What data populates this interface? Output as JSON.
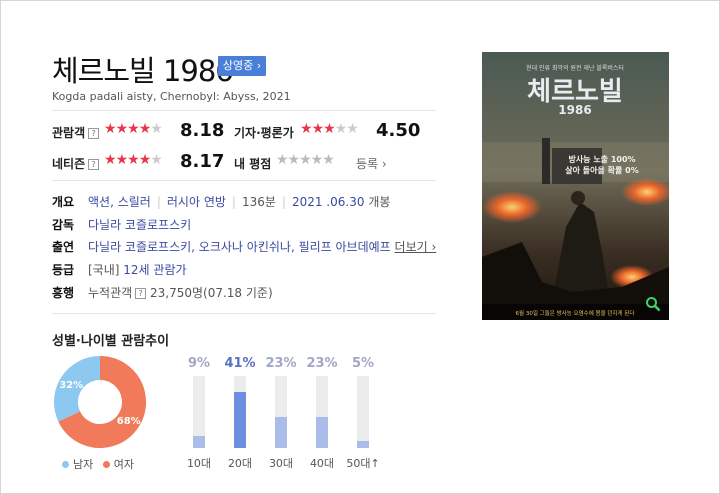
{
  "movie": {
    "title": "체르노빌 1986",
    "status_badge": "상영중 ›",
    "original_title": "Kogda padali aisty, Chernobyl: Abyss, 2021"
  },
  "ratings": {
    "audience": {
      "label": "관람객",
      "help": "?",
      "stars": "★★★★★",
      "value": "8.18",
      "fill": 0.818
    },
    "critic": {
      "label": "기자·평론가",
      "stars": "★★★★★",
      "value": "4.50",
      "fill": 0.45
    },
    "netizen": {
      "label": "네티즌",
      "help": "?",
      "stars": "★★★★★",
      "value": "8.17",
      "fill": 0.817
    },
    "mine": {
      "label": "내 평점",
      "stars": "★★★★★",
      "register": "등록 ›"
    }
  },
  "info": {
    "overview": {
      "label": "개요",
      "genres": "액션, 스릴러",
      "country": "러시아 연방",
      "runtime": "136분",
      "release": "2021 .06.30",
      "release_suffix": "개봉"
    },
    "director": {
      "label": "감독",
      "value": "다닐라 코즐로프스키"
    },
    "cast": {
      "label": "출연",
      "value": "다닐라 코즐로프스키, 오크사나 아킨쉬나, 필리프 아브데예프",
      "more": "더보기 ›"
    },
    "grade": {
      "label": "등급",
      "prefix": "[국내]",
      "value": "12세 관람가"
    },
    "boxoffice": {
      "label": "흥행",
      "prefix": "누적관객",
      "help": "?",
      "value": "23,750명",
      "date": "(07.18 기준)"
    }
  },
  "audience_trend": {
    "title": "성별·나이별 관람추이",
    "gender": [
      {
        "name": "남자",
        "label": "32%",
        "value": 32,
        "color": "#8cc8f0"
      },
      {
        "name": "여자",
        "label": "68%",
        "value": 68,
        "color": "#f07a5a"
      }
    ],
    "ages": [
      {
        "age": "10대",
        "label": "9%",
        "value": 9
      },
      {
        "age": "20대",
        "label": "41%",
        "value": 41,
        "highlight": true
      },
      {
        "age": "30대",
        "label": "23%",
        "value": 23
      },
      {
        "age": "40대",
        "label": "23%",
        "value": 23
      },
      {
        "age": "50대↑",
        "label": "5%",
        "value": 5
      }
    ],
    "colors": {
      "bar": "#a9bde8",
      "bar_highlight": "#6f8ee0",
      "pct": "#a0a8c8",
      "pct_highlight": "#5a6fc8"
    }
  },
  "poster": {
    "tagline": "현대 인류 최악의 원전 재난 블록버스터",
    "title_main": "체르노빌",
    "title_year": "1986",
    "copy_line1": "방사능 노출 100%",
    "copy_line2": "살아 돌아올 확률 0%",
    "bottom_text": "6월 30일 그들은 방사능 오염수에 몸을 던지게 된다",
    "zoom_icon": "magnifier-icon"
  }
}
